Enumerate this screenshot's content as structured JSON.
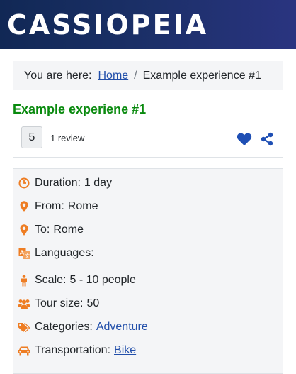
{
  "header": {
    "logo_text": "CASSIOPEIA"
  },
  "breadcrumb": {
    "label": "You are here:",
    "home_link": "Home",
    "separator": "/",
    "current": "Example experience #1"
  },
  "experience": {
    "title": "Example experiene #1",
    "rating_value": "5",
    "review_count": "1 review"
  },
  "details": {
    "duration": {
      "label": "Duration:",
      "value": "1 day"
    },
    "from": {
      "label": "From:",
      "value": "Rome"
    },
    "to": {
      "label": "To:",
      "value": "Rome"
    },
    "languages": {
      "label": "Languages:"
    },
    "scale": {
      "label": "Scale:",
      "value": "5 - 10 people"
    },
    "tour_size": {
      "label": "Tour size:",
      "value": "50"
    },
    "categories": {
      "label": "Categories:",
      "link": "Adventure"
    },
    "transportation": {
      "label": "Transportation:",
      "link": "Bike"
    }
  },
  "colors": {
    "header_bg": "#1a2f66",
    "title_green": "#098a0e",
    "link_blue": "#224faa",
    "icon_orange": "#ee7d23",
    "action_blue": "#1f4fb4"
  },
  "icons": [
    "clock-icon",
    "map-pin-icon",
    "language-icon",
    "person-icon",
    "users-icon",
    "tags-icon",
    "car-icon",
    "heart-icon",
    "share-icon"
  ]
}
